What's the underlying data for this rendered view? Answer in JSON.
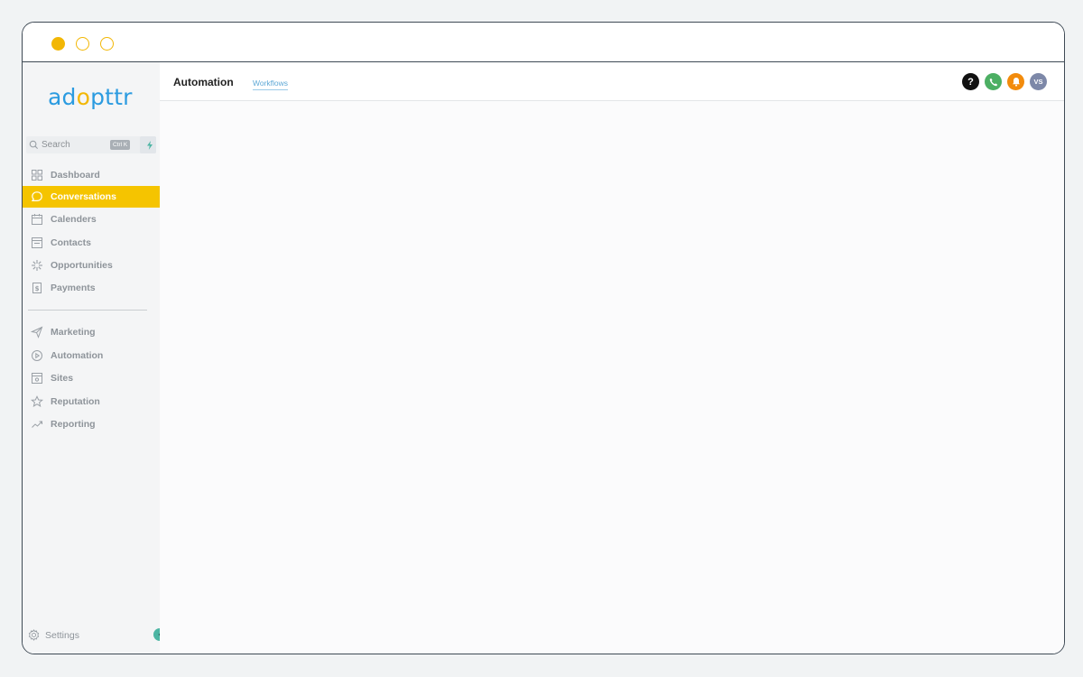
{
  "window": {
    "controls": [
      "traffic-light-1",
      "traffic-light-2",
      "traffic-light-3"
    ],
    "accent_color": "#f2b705"
  },
  "sidebar": {
    "logo_prefix": "ad",
    "logo_o": "o",
    "logo_suffix": "pttr",
    "search": {
      "placeholder": "Search",
      "shortcut": "Ctrl K"
    },
    "items": [
      {
        "label": "Dashboard",
        "icon": "grid-icon",
        "active": false
      },
      {
        "label": "Conversations",
        "icon": "chat-icon",
        "active": true
      },
      {
        "label": "Calenders",
        "icon": "calendar-icon",
        "active": false
      },
      {
        "label": "Contacts",
        "icon": "contact-card-icon",
        "active": false
      },
      {
        "label": "Opportunities",
        "icon": "sparkle-icon",
        "active": false
      },
      {
        "label": "Payments",
        "icon": "receipt-icon",
        "active": false
      }
    ],
    "items2": [
      {
        "label": "Marketing",
        "icon": "send-icon",
        "active": false
      },
      {
        "label": "Automation",
        "icon": "play-circle-icon",
        "active": false
      },
      {
        "label": "Sites",
        "icon": "browser-icon",
        "active": false
      },
      {
        "label": "Reputation",
        "icon": "star-icon",
        "active": false
      },
      {
        "label": "Reporting",
        "icon": "trend-icon",
        "active": false
      }
    ],
    "settings_label": "Settings",
    "active_color": "#f5c400"
  },
  "header": {
    "title": "Automation",
    "tab": "Workflows",
    "icons": [
      "help-icon",
      "phone-icon",
      "bell-icon",
      "avatar"
    ],
    "help_glyph": "?",
    "avatar_initials": "VS"
  }
}
